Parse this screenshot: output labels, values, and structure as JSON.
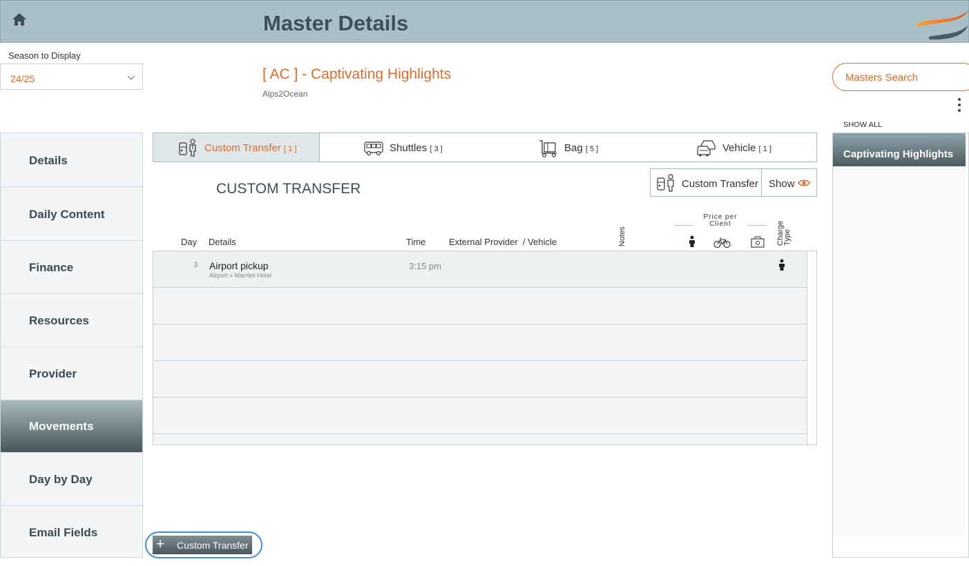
{
  "header": {
    "title": "Master Details",
    "home_icon": "home-icon",
    "logo": "brand-swoosh-logo"
  },
  "season": {
    "label": "Season to Display",
    "value": "24/25"
  },
  "master": {
    "title": "[ AC ] - Captivating Highlights",
    "subtitle": "Alps2Ocean"
  },
  "right": {
    "search_label": "Masters Search",
    "show_all": "SHOW ALL",
    "items": [
      {
        "label": "Captivating Highlights",
        "active": true
      }
    ]
  },
  "nav": {
    "items": [
      {
        "label": "Details"
      },
      {
        "label": "Daily Content"
      },
      {
        "label": "Finance"
      },
      {
        "label": "Resources"
      },
      {
        "label": "Provider"
      },
      {
        "label": "Movements",
        "active": true
      },
      {
        "label": "Day by Day"
      },
      {
        "label": "Email Fields"
      }
    ]
  },
  "tabs": [
    {
      "label": "Custom Transfer",
      "count": "[ 1 ]",
      "icon": "chauffeur-icon",
      "active": true
    },
    {
      "label": "Shuttles",
      "count": "[ 3 ]",
      "icon": "bus-icon"
    },
    {
      "label": "Bag",
      "count": "[ 5 ]",
      "icon": "luggage-cart-icon"
    },
    {
      "label": "Vehicle",
      "count": "[ 1 ]",
      "icon": "cars-icon"
    }
  ],
  "section": {
    "title": "CUSTOM TRANSFER",
    "filter_label": "Custom Transfer",
    "show_label": "Show"
  },
  "table": {
    "headers": {
      "day": "Day",
      "details": "Details",
      "time": "Time",
      "provider": "External Provider  / Vehicle",
      "notes": "Notes",
      "price": "Price per Client",
      "charge": "Charge Type"
    },
    "rows": [
      {
        "day": "3",
        "details": "Airport pickup",
        "route": "Airport » Marriiot Hotel",
        "time": "3:15 pm",
        "charge_type": "person-icon"
      }
    ]
  },
  "add_button": {
    "label": "Custom Transfer"
  },
  "colors": {
    "accent": "#e8692a",
    "header_bg": "#a8bfc5",
    "nav_active": "#4a5a61",
    "focus_ring": "#3b8ee8"
  }
}
